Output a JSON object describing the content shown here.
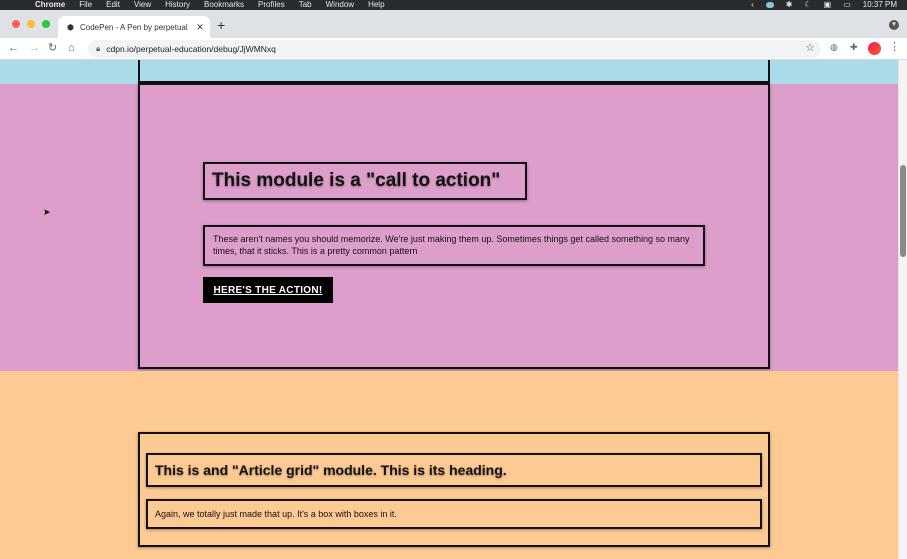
{
  "menubar": {
    "apple": "",
    "items": [
      "Chrome",
      "File",
      "Edit",
      "View",
      "History",
      "Bookmarks",
      "Profiles",
      "Tab",
      "Window",
      "Help"
    ],
    "clock": "10:37 PM"
  },
  "browser": {
    "tab_title": "CodePen - A Pen by perpetual",
    "tab_close": "✕",
    "new_tab": "+",
    "url": "cdpn.io/perpetual-education/debug/JjWMNxq",
    "colors": {
      "close": "#ff5f57",
      "minimize": "#febc2e",
      "zoom": "#28c840"
    }
  },
  "page": {
    "colors": {
      "top_band": "#a9dce8",
      "cta_band": "#dd9ecb",
      "article_band": "#fdca94"
    },
    "cta_module": {
      "heading": "This module is a \"call to action\"",
      "text": "These aren't names you should memorize. We're just making them up. Sometimes things get called something so many times, that it sticks. This is a pretty common pattern",
      "button_label": "HERE'S THE ACTION!"
    },
    "article_module": {
      "heading": "This is and \"Article grid\" module. This is its heading.",
      "text": "Again, we totally just made that up. It's a box with boxes in it."
    }
  }
}
